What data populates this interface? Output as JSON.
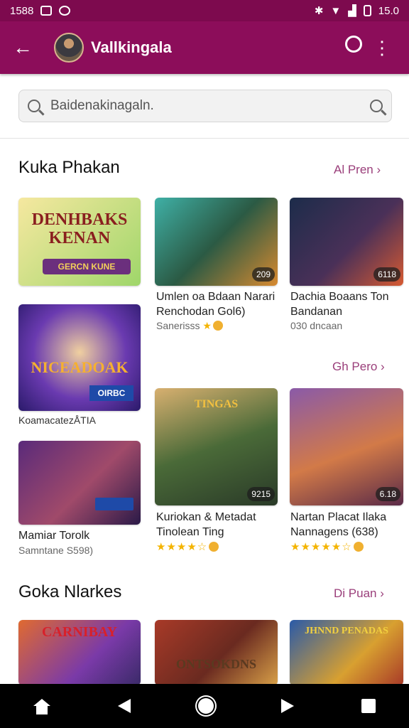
{
  "status_bar": {
    "left_time": "1588",
    "right_time": "15.0"
  },
  "app_bar": {
    "title": "Vallkingala"
  },
  "search": {
    "value": "Baidenakinagaln."
  },
  "sections": [
    {
      "title": "Kuka Phakan",
      "more": "Al Pren"
    },
    {
      "more": "Gh Pero"
    },
    {
      "title": "Goka Nlarkes",
      "more": "Di Puan"
    }
  ],
  "cards": [
    {
      "art": "DENHBAKS\nKENAN",
      "art2": "GERCN KUNE"
    },
    {
      "badge": "209",
      "title": "Umlen oa Bdaan Narari Renchodan Gol6)",
      "sub": "Sanerisss"
    },
    {
      "badge": "6118",
      "title": "Dachia Boaans Ton Bandanan",
      "sub": "030 dncaan"
    },
    {
      "art": "NICEADOAK",
      "art2": "OIRBC",
      "caption": "KoamacatezÅTIA"
    },
    {
      "badge": "9215",
      "title": "Kuriokan & Metadat Tinolean Ting",
      "art": "TINGAS"
    },
    {
      "badge": "6.18",
      "title": "Nartan Placat Ilaka Nannagens (638)"
    },
    {
      "title": "Mamiar Torolk",
      "sub": "Samntane S598)"
    },
    {
      "art": "CARNIBAY"
    },
    {
      "art": "ONTSOKDNS"
    },
    {
      "art": "JHNND PENADAS"
    }
  ],
  "colors": {
    "app_bar": "#8c0d5a",
    "status_bar": "#7d0a4e",
    "accent": "#9a3e7a"
  }
}
